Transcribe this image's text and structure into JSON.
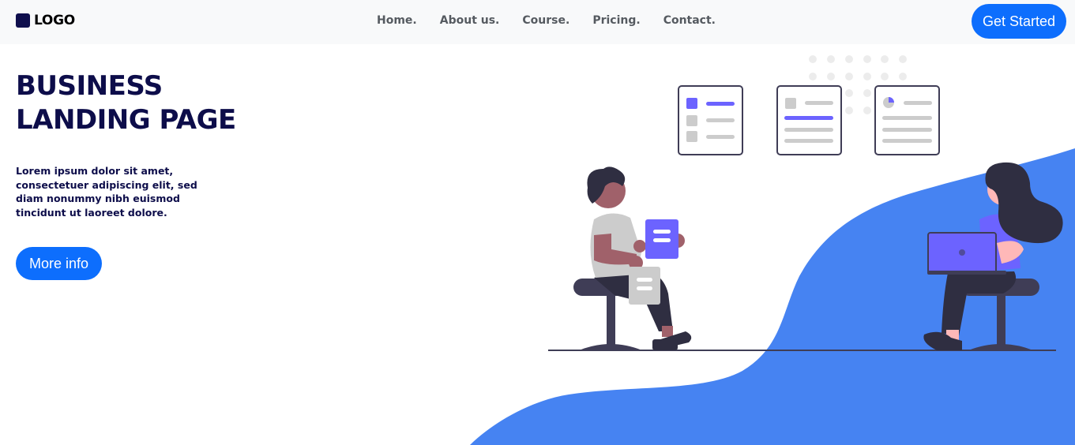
{
  "navbar": {
    "brand": "LOGO",
    "links": [
      "Home.",
      "About us.",
      "Course.",
      "Pricing.",
      "Contact."
    ],
    "cta_label": "Get Started"
  },
  "hero": {
    "title_line1": "BUSINESS",
    "title_line2": "LANDING PAGE",
    "text": "Lorem ipsum dolor sit amet, consectetuer adipiscing elit, sed diam nonummy nibh euismod tincidunt ut laoreet dolore.",
    "button_label": "More info"
  },
  "illustration": {
    "subject": "two people working with dashboard cards",
    "icons": [
      "person-with-document-icon",
      "person-with-laptop-icon",
      "dashboard-card-icon"
    ]
  },
  "colors": {
    "accent": "#0d6efd",
    "navy": "#0d0d4a",
    "wave": "#4683f2",
    "purple": "#6c63ff",
    "navbar_bg": "#f8f9fa"
  }
}
